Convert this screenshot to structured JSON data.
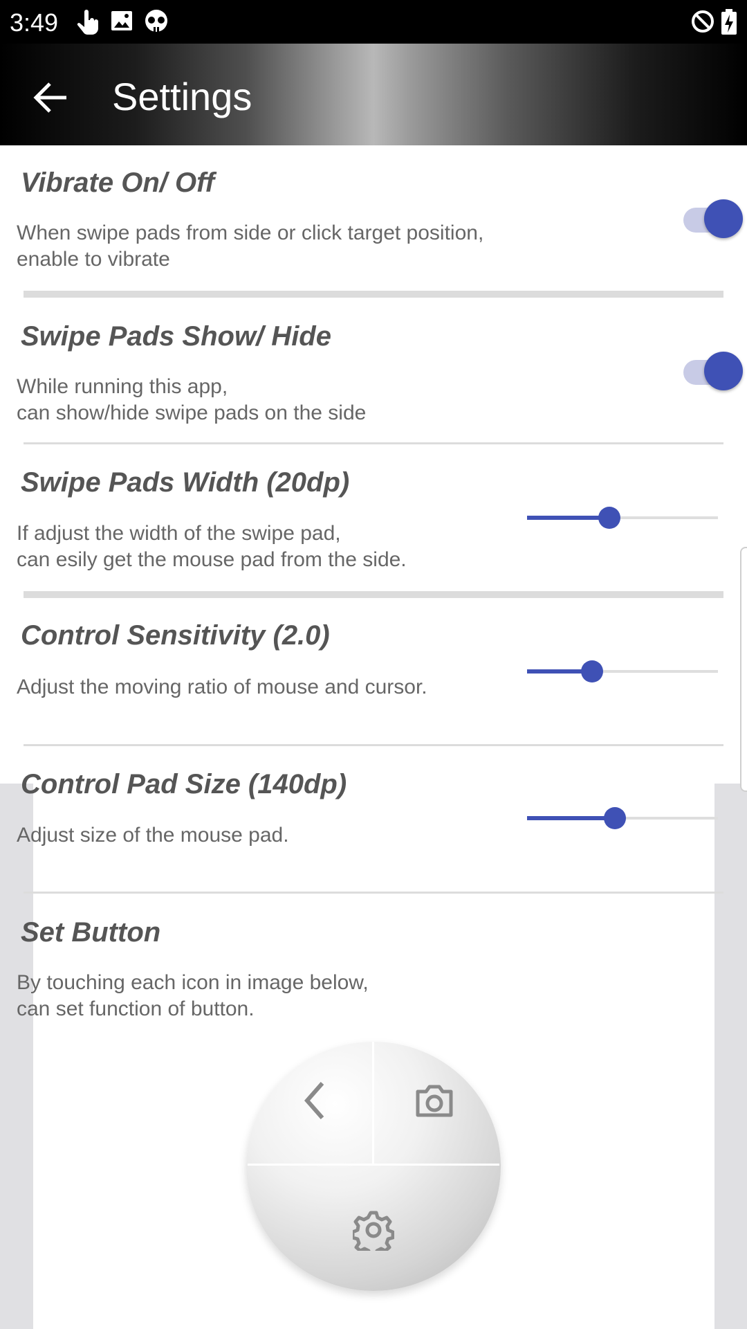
{
  "status_bar": {
    "time": "3:49",
    "left_icons": [
      "touch-icon",
      "image-icon",
      "skull-icon"
    ],
    "right_icons": [
      "do-not-disturb-icon",
      "battery-charging-icon"
    ]
  },
  "app_bar": {
    "title": "Settings",
    "back_icon": "arrow-back-icon"
  },
  "settings": {
    "vibrate": {
      "title": "Vibrate On/ Off",
      "description": "When swipe pads from side or click target position,\nenable to vibrate",
      "enabled": true
    },
    "swipe_pads_show": {
      "title": "Swipe Pads Show/ Hide",
      "description": "While running this app,\ncan show/hide swipe pads on the side",
      "enabled": true
    },
    "swipe_pads_width": {
      "title": "Swipe Pads Width (20dp)",
      "description": "If adjust the width of the swipe pad,\ncan esily get the mouse pad from the side.",
      "level": 0.43
    },
    "control_sensitivity": {
      "title": "Control Sensitivity (2.0)",
      "description": "Adjust the moving ratio of mouse and cursor.",
      "level": 0.34
    },
    "control_pad_size": {
      "title": "Control Pad Size (140dp)",
      "description": "Adjust size of the mouse pad.",
      "level": 0.46
    },
    "set_button": {
      "title": "Set Button",
      "description": "By touching each icon in image below,\ncan set function of button.",
      "pad_icons": [
        "chevron-left-icon",
        "camera-icon",
        "gear-icon"
      ]
    }
  },
  "colors": {
    "accent": "#3f51b5",
    "switch_track": "#c8cbe6",
    "title_text": "#555555",
    "desc_text": "#666666"
  }
}
